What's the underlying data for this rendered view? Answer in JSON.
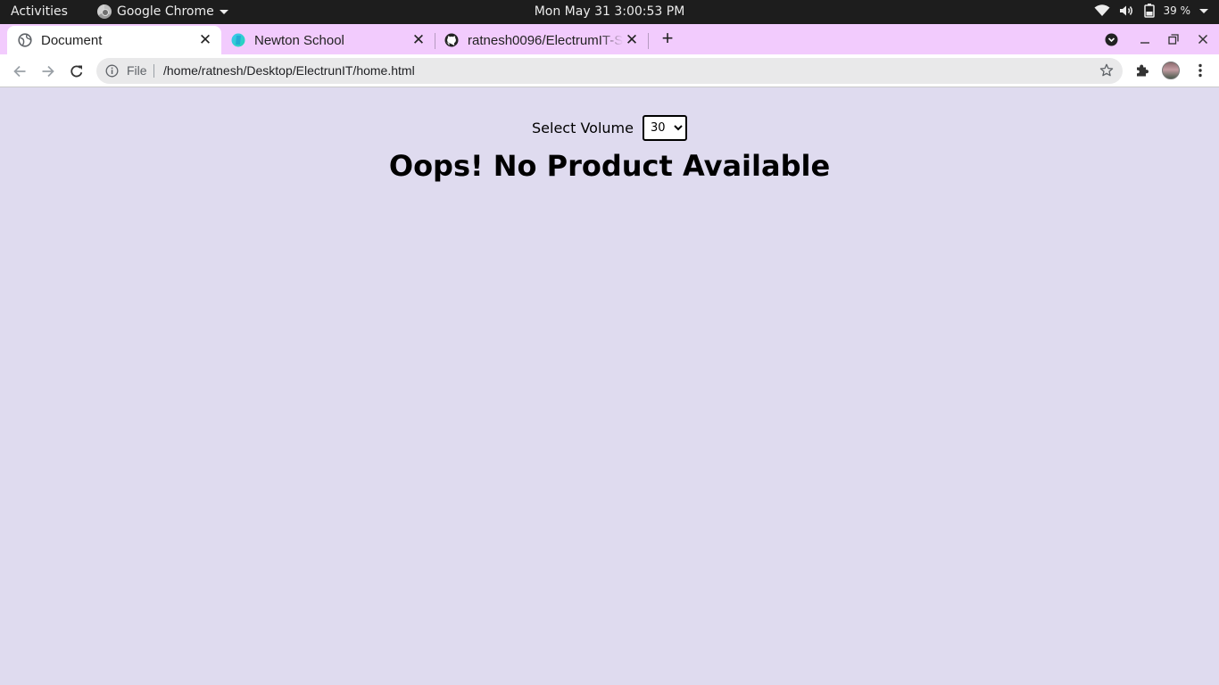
{
  "system_bar": {
    "activities": "Activities",
    "app_name": "Google Chrome",
    "clock": "Mon May 31   3:00:53 PM",
    "battery": "39 %"
  },
  "browser": {
    "tabs": [
      {
        "title": "Document",
        "icon": "globe-icon",
        "active": true
      },
      {
        "title": "Newton School",
        "icon": "newton-school-icon",
        "active": false
      },
      {
        "title": "ratnesh0096/ElectrumIT-S",
        "icon": "github-icon",
        "active": false
      }
    ],
    "address": {
      "scheme_label": "File",
      "url": "/home/ratnesh/Desktop/ElectrunIT/home.html"
    },
    "tabstrip_color": "#f2cbfd"
  },
  "page": {
    "volume_label": "Select Volume",
    "volume_value": "30",
    "message": "Oops! No Product Available",
    "background": "#dfdbef"
  }
}
